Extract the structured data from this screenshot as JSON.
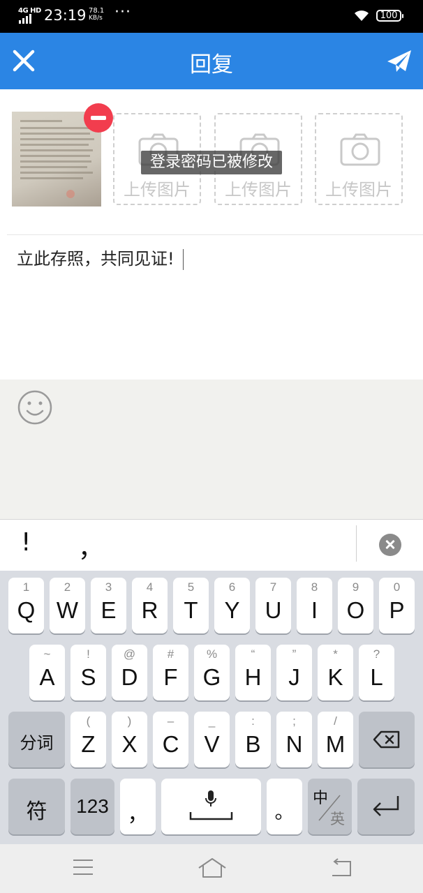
{
  "status_bar": {
    "network": "4G HD",
    "time": "23:19",
    "speed_value": "78.1",
    "speed_unit": "KB/s",
    "overflow": "···",
    "battery": "100"
  },
  "header": {
    "title": "回复",
    "close_icon": "close-icon",
    "send_icon": "paper-plane-icon",
    "background": "#2b85e4"
  },
  "attachments": {
    "upload_label": "上传图片",
    "slots": [
      {
        "label": "上传图片"
      },
      {
        "label": "上传图片"
      },
      {
        "label": "上传图片"
      }
    ],
    "remove_color": "#f23d4e"
  },
  "toast": "登录密码已被修改",
  "reply_text": "立此存照，共同见证!",
  "emoji_icon": "smiley-icon",
  "candidates": [
    "!",
    "，"
  ],
  "keyboard": {
    "row1": [
      {
        "key": "Q",
        "sub": "1"
      },
      {
        "key": "W",
        "sub": "2"
      },
      {
        "key": "E",
        "sub": "3"
      },
      {
        "key": "R",
        "sub": "4"
      },
      {
        "key": "T",
        "sub": "5"
      },
      {
        "key": "Y",
        "sub": "6"
      },
      {
        "key": "U",
        "sub": "7"
      },
      {
        "key": "I",
        "sub": "8"
      },
      {
        "key": "O",
        "sub": "9"
      },
      {
        "key": "P",
        "sub": "0"
      }
    ],
    "row2": [
      {
        "key": "A",
        "sub": "~"
      },
      {
        "key": "S",
        "sub": "!"
      },
      {
        "key": "D",
        "sub": "@"
      },
      {
        "key": "F",
        "sub": "#"
      },
      {
        "key": "G",
        "sub": "%"
      },
      {
        "key": "H",
        "sub": "“"
      },
      {
        "key": "J",
        "sub": "”"
      },
      {
        "key": "K",
        "sub": "*"
      },
      {
        "key": "L",
        "sub": "?"
      }
    ],
    "row3": [
      {
        "key": "Z",
        "sub": "("
      },
      {
        "key": "X",
        "sub": ")"
      },
      {
        "key": "C",
        "sub": "–"
      },
      {
        "key": "V",
        "sub": "_"
      },
      {
        "key": "B",
        "sub": ":"
      },
      {
        "key": "N",
        "sub": ";"
      },
      {
        "key": "M",
        "sub": "/"
      }
    ],
    "segment_key": "分词",
    "symbol_key": "符",
    "number_key": "123",
    "comma_key": "，",
    "period_key": "。",
    "lang_cn": "中",
    "lang_en": "英"
  },
  "nav_bar": {
    "menu_icon": "menu-icon",
    "home_icon": "home-icon",
    "back_icon": "back-icon"
  }
}
